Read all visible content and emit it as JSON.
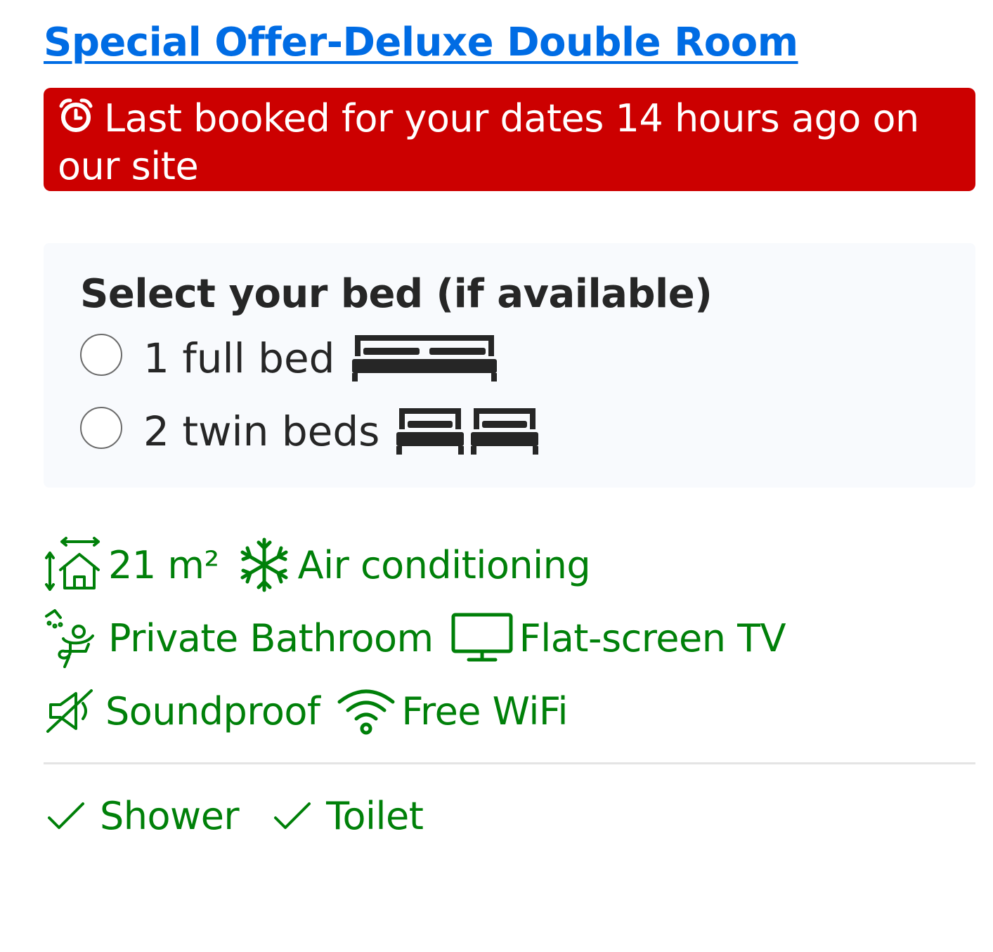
{
  "room": {
    "title": "Special Offer-Deluxe Double Room"
  },
  "urgency": {
    "icon": "alarm-clock-icon",
    "message": "Last booked for your dates 14 hours ago on our site",
    "background_color": "#cc0000"
  },
  "bed_selection": {
    "heading": "Select your bed (if available)",
    "options": [
      {
        "label": "1 full bed",
        "icon": "double-bed-icon",
        "selected": false
      },
      {
        "label": "2 twin beds",
        "icon": "twin-beds-icon",
        "selected": false
      }
    ]
  },
  "facilities": [
    {
      "label": "21 m²",
      "icon": "room-size-icon"
    },
    {
      "label": "Air conditioning",
      "icon": "snowflake-icon"
    },
    {
      "label": "Private Bathroom",
      "icon": "bathroom-icon"
    },
    {
      "label": "Flat-screen TV",
      "icon": "tv-icon"
    },
    {
      "label": "Soundproof",
      "icon": "soundproof-icon"
    },
    {
      "label": "Free WiFi",
      "icon": "wifi-icon"
    }
  ],
  "bathroom_extras": [
    {
      "label": "Shower",
      "icon": "checkmark-icon"
    },
    {
      "label": "Toilet",
      "icon": "checkmark-icon"
    }
  ],
  "colors": {
    "link_blue": "#006ce4",
    "facility_green": "#008009",
    "text_dark": "#262626"
  }
}
